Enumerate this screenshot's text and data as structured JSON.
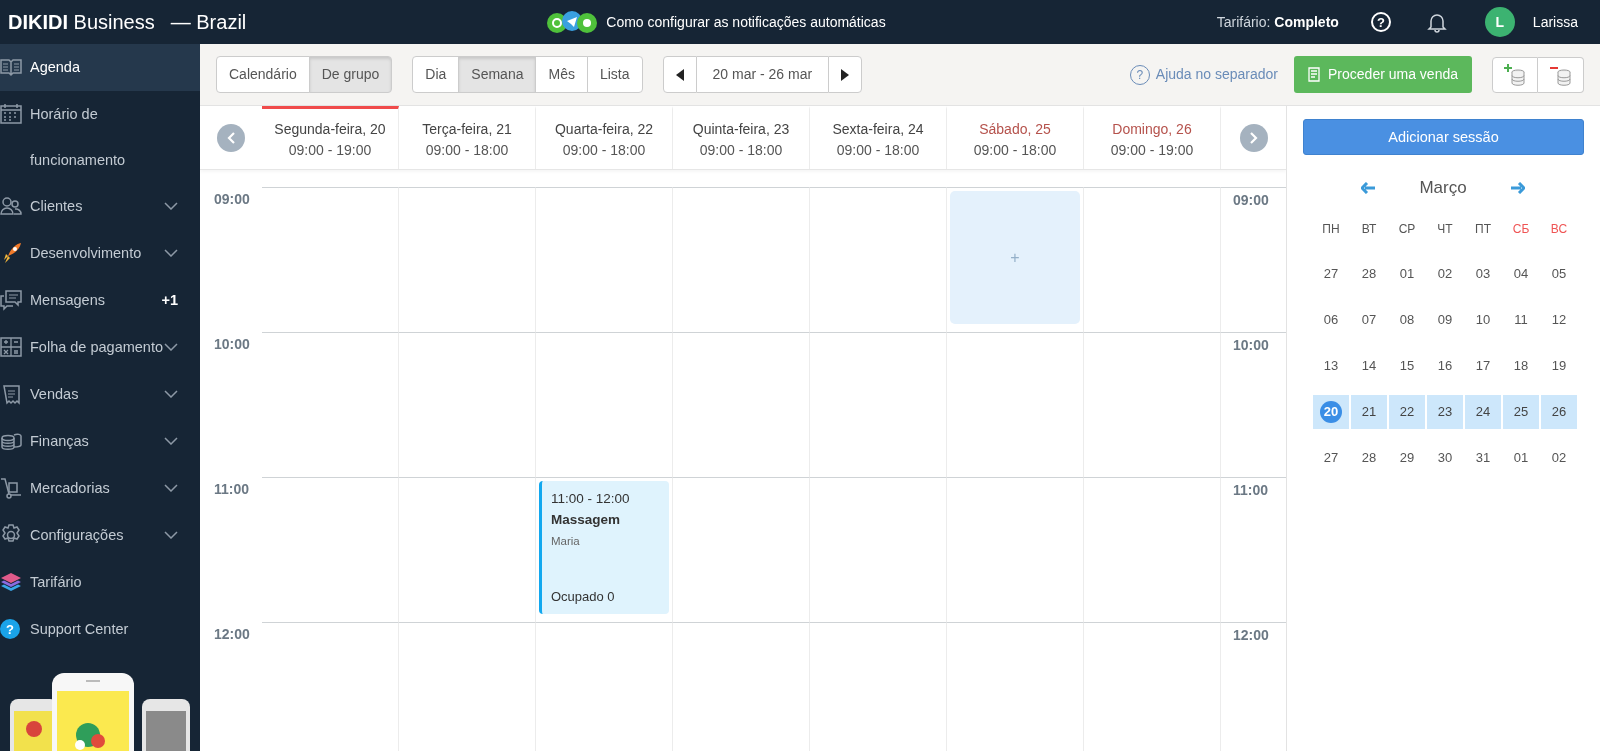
{
  "topbar": {
    "brand": "**DIKIDI** Business",
    "region": "— Brazil",
    "promo": "Como configurar as notificações automáticas",
    "tariff_label": "Tarifário:",
    "tariff": "Completo",
    "help_glyph": "?",
    "avatar": "L",
    "user": "Larissa"
  },
  "sidebar": {
    "items": [
      {
        "label": "Agenda",
        "selected": true,
        "expandable": false
      },
      {
        "label": "Horário de funcionamento",
        "selected": false,
        "expandable": false
      },
      {
        "label": "Clientes",
        "selected": false,
        "expandable": true
      },
      {
        "label": "Desenvolvimento",
        "selected": false,
        "expandable": true
      },
      {
        "label": "Mensagens",
        "selected": false,
        "expandable": false,
        "badge": "+1"
      },
      {
        "label": "Folha de pagamento",
        "selected": false,
        "expandable": true
      },
      {
        "label": "Vendas",
        "selected": false,
        "expandable": true
      },
      {
        "label": "Finanças",
        "selected": false,
        "expandable": true
      },
      {
        "label": "Mercadorias",
        "selected": false,
        "expandable": true
      },
      {
        "label": "Configurações",
        "selected": false,
        "expandable": true
      },
      {
        "label": "Tarifário",
        "selected": false,
        "expandable": false
      },
      {
        "label": "Support Center",
        "selected": false,
        "expandable": false,
        "icon_glyph": "?"
      }
    ]
  },
  "toolbar": {
    "modes": [
      {
        "label": "Calendário",
        "selected": false
      },
      {
        "label": "De grupo",
        "selected": true
      }
    ],
    "periods": [
      {
        "label": "Dia",
        "selected": false
      },
      {
        "label": "Semana",
        "selected": true
      },
      {
        "label": "Mês",
        "selected": false
      },
      {
        "label": "Lista",
        "selected": false
      }
    ],
    "date_range": "20 mar - 26 mar",
    "help_glyph": "?",
    "help": "Ajuda no separador",
    "sale_button": "Proceder uma venda"
  },
  "days": [
    {
      "label": "Segunda-feira, 20",
      "hours": "09:00 - 19:00",
      "selected": true,
      "weekend": false
    },
    {
      "label": "Terça-feira, 21",
      "hours": "09:00 - 18:00",
      "selected": false,
      "weekend": false
    },
    {
      "label": "Quarta-feira, 22",
      "hours": "09:00 - 18:00",
      "selected": false,
      "weekend": false,
      "events": [
        {
          "kind": "session",
          "time": "11:00 - 12:00",
          "title": "Massagem",
          "person": "Maria",
          "occupancy": "Ocupado 0"
        }
      ]
    },
    {
      "label": "Quinta-feira, 23",
      "hours": "09:00 - 18:00",
      "selected": false,
      "weekend": false
    },
    {
      "label": "Sexta-feira, 24",
      "hours": "09:00 - 18:00",
      "selected": false,
      "weekend": false
    },
    {
      "label": "Sábado, 25",
      "hours": "09:00 - 18:00",
      "selected": false,
      "weekend": true,
      "events": [
        {
          "kind": "add",
          "label": "+"
        }
      ]
    },
    {
      "label": "Domingo, 26",
      "hours": "09:00 - 19:00",
      "selected": false,
      "weekend": true
    }
  ],
  "hours": [
    {
      "left": "09:00",
      "right": "09:00"
    },
    {
      "left": "10:00",
      "right": "10:00"
    },
    {
      "left": "11:00",
      "right": "11:00"
    },
    {
      "left": "12:00",
      "right": "12:00"
    }
  ],
  "side_panel": {
    "add_button": "Adicionar sessão",
    "month": "Março",
    "weekdays": [
      {
        "label": "ПН",
        "weekend": false
      },
      {
        "label": "ВТ",
        "weekend": false
      },
      {
        "label": "СР",
        "weekend": false
      },
      {
        "label": "ЧТ",
        "weekend": false
      },
      {
        "label": "ПТ",
        "weekend": false
      },
      {
        "label": "СБ",
        "weekend": true
      },
      {
        "label": "ВС",
        "weekend": true
      }
    ],
    "weeks": [
      [
        {
          "day": "27",
          "selected": false,
          "today": false
        },
        {
          "day": "28",
          "selected": false,
          "today": false
        },
        {
          "day": "01",
          "selected": false,
          "today": false
        },
        {
          "day": "02",
          "selected": false,
          "today": false
        },
        {
          "day": "03",
          "selected": false,
          "today": false
        },
        {
          "day": "04",
          "selected": false,
          "today": false
        },
        {
          "day": "05",
          "selected": false,
          "today": false
        }
      ],
      [
        {
          "day": "06",
          "selected": false,
          "today": false
        },
        {
          "day": "07",
          "selected": false,
          "today": false
        },
        {
          "day": "08",
          "selected": false,
          "today": false
        },
        {
          "day": "09",
          "selected": false,
          "today": false
        },
        {
          "day": "10",
          "selected": false,
          "today": false
        },
        {
          "day": "11",
          "selected": false,
          "today": false
        },
        {
          "day": "12",
          "selected": false,
          "today": false
        }
      ],
      [
        {
          "day": "13",
          "selected": false,
          "today": false
        },
        {
          "day": "14",
          "selected": false,
          "today": false
        },
        {
          "day": "15",
          "selected": false,
          "today": false
        },
        {
          "day": "16",
          "selected": false,
          "today": false
        },
        {
          "day": "17",
          "selected": false,
          "today": false
        },
        {
          "day": "18",
          "selected": false,
          "today": false
        },
        {
          "day": "19",
          "selected": false,
          "today": false
        }
      ],
      [
        {
          "day": "20",
          "selected": true,
          "today": true
        },
        {
          "day": "21",
          "selected": true,
          "today": false
        },
        {
          "day": "22",
          "selected": true,
          "today": false
        },
        {
          "day": "23",
          "selected": true,
          "today": false
        },
        {
          "day": "24",
          "selected": true,
          "today": false
        },
        {
          "day": "25",
          "selected": true,
          "today": false
        },
        {
          "day": "26",
          "selected": true,
          "today": false
        }
      ],
      [
        {
          "day": "27",
          "selected": false,
          "today": false
        },
        {
          "day": "28",
          "selected": false,
          "today": false
        },
        {
          "day": "29",
          "selected": false,
          "today": false
        },
        {
          "day": "30",
          "selected": false,
          "today": false
        },
        {
          "day": "31",
          "selected": false,
          "today": false
        },
        {
          "day": "01",
          "selected": false,
          "today": false
        },
        {
          "day": "02",
          "selected": false,
          "today": false
        }
      ]
    ]
  }
}
